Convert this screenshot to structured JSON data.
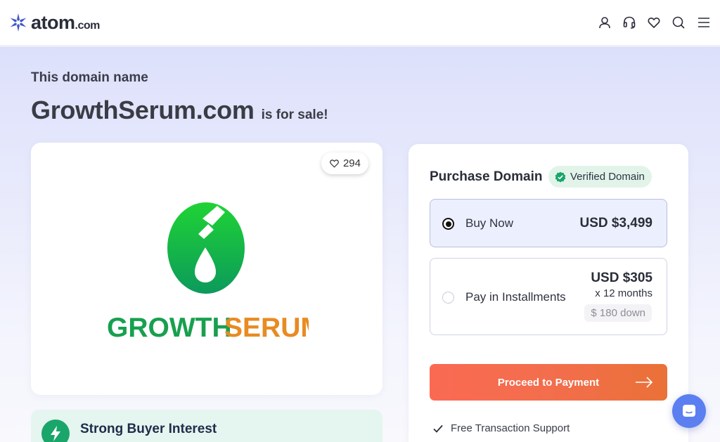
{
  "header": {
    "brand_name": "atom",
    "brand_tld": ".com",
    "icons": [
      "user-icon",
      "headset-icon",
      "heart-icon",
      "search-icon",
      "menu-icon"
    ]
  },
  "hero": {
    "eyebrow": "This domain name",
    "domain": "GrowthSerum.com",
    "for_sale": "is for sale!"
  },
  "logo_card": {
    "likes": "294",
    "brand_word_1": "GROWTH",
    "brand_word_2": "SERUM"
  },
  "interest": {
    "title": "Strong Buyer Interest"
  },
  "purchase": {
    "title": "Purchase Domain",
    "verified_label": "Verified Domain",
    "buy_now": {
      "label": "Buy Now",
      "price": "USD $3,499",
      "selected": true
    },
    "installments": {
      "label": "Pay in Installments",
      "price": "USD $305",
      "months": "x 12 months",
      "down": "$ 180 down",
      "selected": false
    },
    "proceed_label": "Proceed to Payment",
    "support_label": "Free Transaction Support"
  },
  "colors": {
    "accent": "#f26e4b",
    "verified_green": "#1aa56b",
    "brand_blue": "#3b4fc4",
    "chat_blue": "#5b7ff0"
  }
}
